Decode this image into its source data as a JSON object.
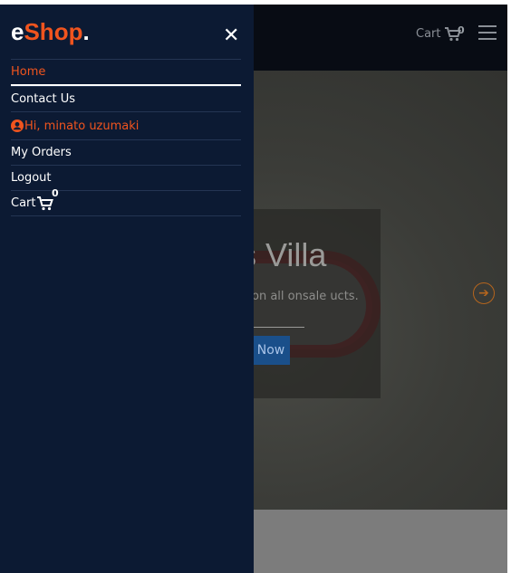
{
  "header": {
    "cart_label": "Cart",
    "cart_count": "0"
  },
  "hero": {
    "title_fragment": "s Villa",
    "subtitle_fragment": "on all onsale ucts.",
    "button_fragment": "Now"
  },
  "drawer": {
    "logo": {
      "e": "e",
      "shop": "Shop",
      "dot": "."
    },
    "close_glyph": "✕",
    "menu": [
      {
        "label": "Home",
        "active": true
      },
      {
        "label": "Contact Us"
      },
      {
        "label": "Hi, minato uzumaki",
        "icon": "user-circle-icon"
      },
      {
        "label": "My Orders"
      },
      {
        "label": "Logout"
      },
      {
        "label": "Cart",
        "count": "0",
        "icon": "shopping-cart-icon"
      }
    ]
  },
  "colors": {
    "accent": "#f0541e",
    "drawer_bg": "#0c1a33"
  }
}
